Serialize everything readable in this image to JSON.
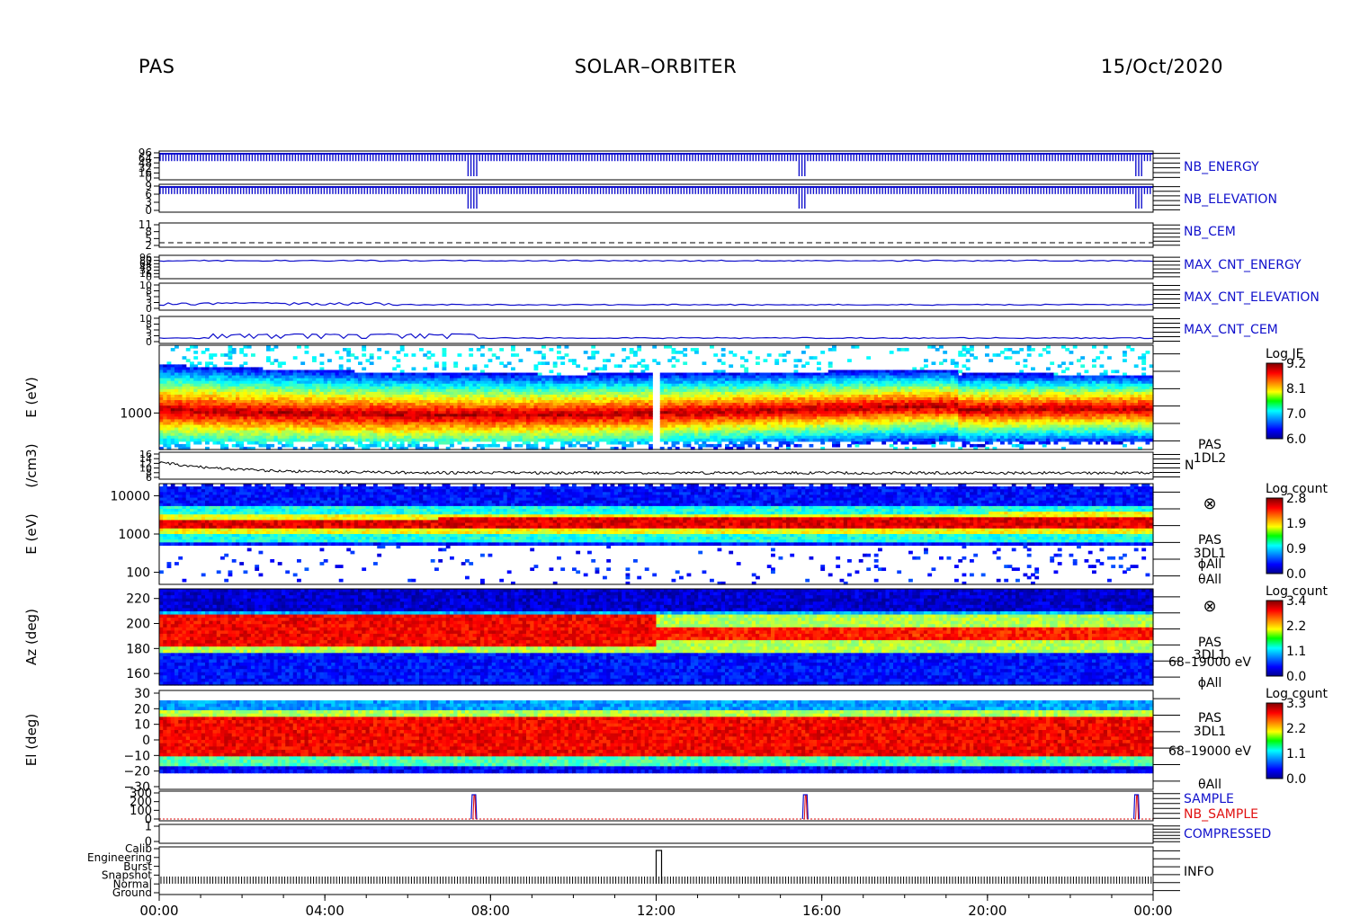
{
  "header": {
    "instrument": "PAS",
    "mission": "SOLAR–ORBITER",
    "date": "15/Oct/2020"
  },
  "time_axis": {
    "tick_labels": [
      "00:00",
      "04:00",
      "08:00",
      "12:00",
      "16:00",
      "20:00",
      "00:00"
    ]
  },
  "colors": {
    "blue": "#1010cc",
    "red": "#e01010",
    "black": "#000000"
  },
  "chart_data": {
    "type": "heatmap",
    "panels": [
      {
        "id": "nb_energy",
        "label": "NB_ENERGY",
        "type": "line",
        "color": "#1010cc",
        "y_ticks": [
          "96",
          "64",
          "48",
          "32",
          "16",
          "0"
        ]
      },
      {
        "id": "nb_elevation",
        "label": "NB_ELEVATION",
        "type": "line",
        "color": "#1010cc",
        "y_ticks": [
          "9",
          "6",
          "3",
          "0"
        ]
      },
      {
        "id": "nb_cem",
        "label": "NB_CEM",
        "type": "line",
        "color": "#1010cc",
        "y_ticks": [
          "11",
          "8",
          "5",
          "2"
        ]
      },
      {
        "id": "max_cnt_energy",
        "label": "MAX_CNT_ENERGY",
        "type": "line",
        "color": "#1010cc",
        "y_ticks": [
          "96",
          "80",
          "64",
          "48",
          "32",
          "16",
          "0"
        ]
      },
      {
        "id": "max_cnt_elevation",
        "label": "MAX_CNT_ELEVATION",
        "type": "line",
        "color": "#1010cc",
        "y_ticks": [
          "10",
          "8",
          "5",
          "3",
          "0"
        ]
      },
      {
        "id": "max_cnt_cem",
        "label": "MAX_CNT_CEM",
        "type": "line",
        "color": "#1010cc",
        "y_ticks": [
          "10",
          "8",
          "5",
          "3",
          "0"
        ]
      },
      {
        "id": "energy_spectrogram",
        "type": "heatmap",
        "ylabel": "E (eV)",
        "y_ticks": [
          "1000"
        ],
        "colorbar": {
          "title": "Log JE",
          "ticks": [
            "9.2",
            "8.1",
            "7.0",
            "6.0"
          ]
        }
      },
      {
        "id": "density",
        "type": "line",
        "ylabel": "(/cm3)",
        "y_ticks": [
          "16",
          "14",
          "12",
          "10",
          "8",
          "6"
        ],
        "annotations": [
          "PAS",
          "1DL2",
          "N"
        ]
      },
      {
        "id": "energy_3d",
        "type": "heatmap",
        "ylabel": "E (eV)",
        "y_ticks": [
          "10000",
          "1000",
          "100"
        ],
        "colorbar": {
          "title": "Log count",
          "ticks": [
            "2.8",
            "1.9",
            "0.9",
            "0.0"
          ]
        },
        "annotations": [
          "⊗",
          "PAS",
          "3DL1",
          "ϕAll",
          "θAll"
        ]
      },
      {
        "id": "azimuth",
        "type": "heatmap",
        "ylabel": "Az (deg)",
        "y_ticks": [
          "220",
          "200",
          "180",
          "160"
        ],
        "colorbar": {
          "title": "Log count",
          "ticks": [
            "3.4",
            "2.2",
            "1.1",
            "0.0"
          ]
        },
        "annotations": [
          "⊗",
          "PAS",
          "3DL1",
          "68–19000 eV",
          "ϕAll"
        ]
      },
      {
        "id": "elevation",
        "type": "heatmap",
        "ylabel": "El (deg)",
        "y_ticks": [
          "30",
          "20",
          "10",
          "0",
          "−10",
          "−20",
          "−30"
        ],
        "colorbar": {
          "title": "Log count",
          "ticks": [
            "3.3",
            "2.2",
            "1.1",
            "0.0"
          ]
        },
        "annotations": [
          "PAS",
          "3DL1",
          "68–19000 eV",
          "θAll"
        ]
      },
      {
        "id": "sample",
        "type": "line",
        "y_ticks": [
          "300",
          "200",
          "100",
          "0"
        ],
        "series": [
          {
            "name": "SAMPLE",
            "color": "#1010cc"
          },
          {
            "name": "NB_SAMPLE",
            "color": "#e01010"
          }
        ],
        "spikes_at_hours": [
          7.6,
          15.6,
          23.6
        ]
      },
      {
        "id": "compressed",
        "label": "COMPRESSED",
        "type": "line",
        "color": "#1010cc",
        "y_ticks": [
          "1",
          "0"
        ]
      },
      {
        "id": "info",
        "label": "INFO",
        "type": "line",
        "y_ticks": [
          "Calib",
          "Engineering",
          "Burst",
          "Snapshot",
          "Normal",
          "Ground"
        ],
        "state_change_hour": 12.0
      }
    ]
  }
}
